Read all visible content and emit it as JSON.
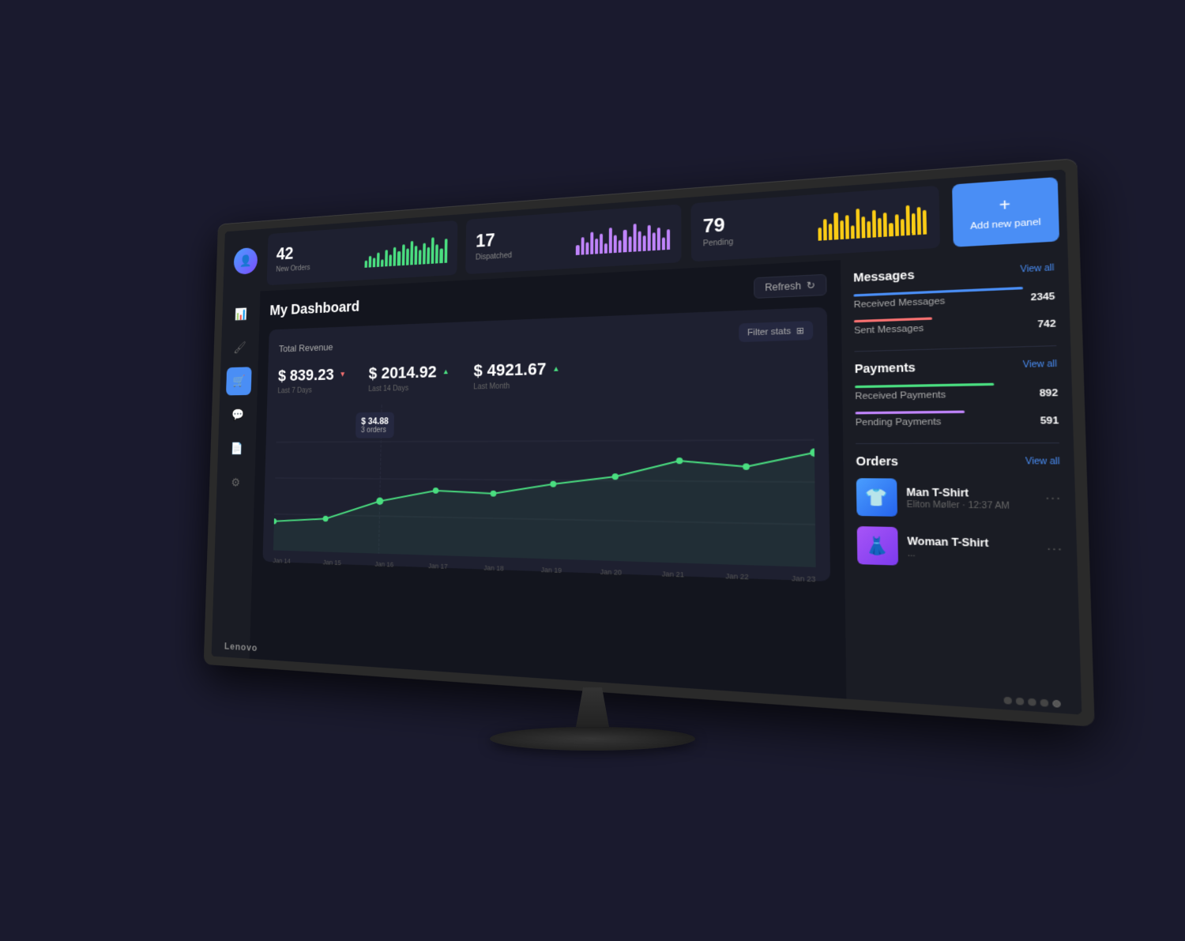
{
  "monitor": {
    "brand": "Lenovo"
  },
  "topbar": {
    "stats": [
      {
        "number": "42",
        "label": "New Orders",
        "color": "#4ade80",
        "bars": [
          3,
          5,
          4,
          6,
          3,
          7,
          5,
          8,
          6,
          9,
          7,
          10,
          8,
          6,
          9,
          7,
          11,
          8,
          6,
          10
        ]
      },
      {
        "number": "17",
        "label": "Dispatched",
        "color": "#c084fc",
        "bars": [
          4,
          7,
          5,
          9,
          6,
          8,
          4,
          10,
          7,
          5,
          9,
          6,
          11,
          8,
          6,
          10,
          7,
          9,
          5,
          8
        ]
      },
      {
        "number": "79",
        "label": "Pending",
        "color": "#facc15",
        "bars": [
          5,
          8,
          6,
          10,
          7,
          9,
          5,
          11,
          8,
          6,
          10,
          7,
          9,
          5,
          8,
          6,
          11,
          8,
          10,
          9
        ]
      }
    ],
    "add_panel": {
      "plus": "+",
      "label": "Add new panel"
    }
  },
  "sidebar": {
    "icons": [
      {
        "name": "chart-icon",
        "symbol": "📊",
        "active": false
      },
      {
        "name": "brush-icon",
        "symbol": "🖌",
        "active": false
      },
      {
        "name": "cart-icon",
        "symbol": "🛒",
        "active": true
      },
      {
        "name": "chat-icon",
        "symbol": "💬",
        "active": false
      },
      {
        "name": "file-icon",
        "symbol": "📄",
        "active": false
      },
      {
        "name": "settings-icon",
        "symbol": "⚙",
        "active": false
      }
    ]
  },
  "dashboard": {
    "title": "My Dashboard",
    "refresh_label": "Refresh",
    "revenue_card": {
      "title": "Total Revenue",
      "filter_label": "Filter stats",
      "stats": [
        {
          "amount": "$ 839.23",
          "period": "Last 7 Days",
          "trend": "down",
          "indicator": "▼"
        },
        {
          "amount": "$ 2014.92",
          "period": "Last 14 Days",
          "trend": "up",
          "indicator": "▲"
        },
        {
          "amount": "$ 4921.67",
          "period": "Last Month",
          "trend": "up",
          "indicator": "▲"
        }
      ],
      "tooltip": {
        "amount": "$ 34.88",
        "orders": "3 orders"
      },
      "x_labels": [
        "Jan 14",
        "Jan 15",
        "Jan 16",
        "Jan 17",
        "Jan 18",
        "Jan 19",
        "Jan 20",
        "Jan 21",
        "Jan 22",
        "Jan 23"
      ]
    }
  },
  "right_panel": {
    "messages": {
      "title": "Messages",
      "view_all": "View all",
      "items": [
        {
          "label": "Received Messages",
          "count": "2345",
          "bar_color": "#4a8ef5",
          "bar_width": "85%"
        },
        {
          "label": "Sent Messages",
          "count": "742",
          "bar_color": "#f87171",
          "bar_width": "40%"
        }
      ]
    },
    "payments": {
      "title": "Payments",
      "view_all": "View all",
      "items": [
        {
          "label": "Received Payments",
          "count": "892",
          "bar_color": "#4ade80",
          "bar_width": "70%"
        },
        {
          "label": "Pending Payments",
          "count": "591",
          "bar_color": "#c084fc",
          "bar_width": "55%"
        }
      ]
    },
    "orders": {
      "title": "Orders",
      "view_all": "View all",
      "items": [
        {
          "name": "Man T-Shirt",
          "sub": "Eliton Møller · 12:37 AM",
          "emoji": "👕",
          "color1": "#4a9eff",
          "color2": "#2563eb"
        },
        {
          "name": "Woman T-Shirt",
          "sub": "...",
          "emoji": "👗",
          "color1": "#a855f7",
          "color2": "#7c3aed"
        }
      ]
    }
  }
}
